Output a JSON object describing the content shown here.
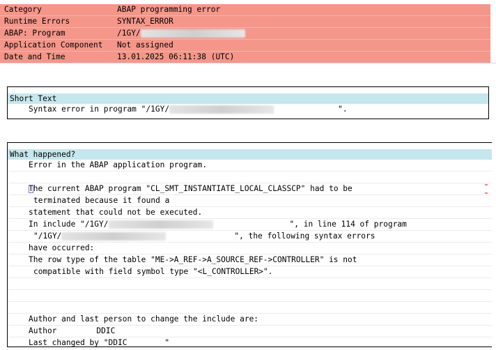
{
  "header": {
    "rows": [
      {
        "key": "Category",
        "value": "ABAP programming error"
      },
      {
        "key": "Runtime Errors",
        "value": "SYNTAX_ERROR"
      },
      {
        "key": "ABAP: Program",
        "value": "/1GY/"
      },
      {
        "key": "Application Component",
        "value": "Not assigned"
      },
      {
        "key": "Date and Time",
        "value": "13.01.2025 06:11:38 (UTC)"
      }
    ]
  },
  "short_text": {
    "title": "Short Text",
    "line_prefix": "Syntax error in program \"/1GY/",
    "line_suffix": "\"."
  },
  "what_happened": {
    "title": "What happened?",
    "intro": "Error in the ABAP application program.",
    "l1": "he current ABAP program \"CL_SMT_INSTANTIATE_LOCAL_CLASSCP\" had to be",
    "l1_first": "T",
    "l2": "terminated because it found a",
    "l3": "statement that could not be executed.",
    "l4_prefix": "In include \"/1GY/",
    "l4_suffix": "\", in line 114 of program",
    "l5_prefix": "\"/1GY/",
    "l5_suffix": "\", the following syntax errors",
    "l6": "have occurred:",
    "l7": "The row type of the table \"ME->A_REF->A_SOURCE_REF->CONTROLLER\" is not",
    "l8": "compatible with field symbol type \"<L_CONTROLLER>\".",
    "l9": "Author and last person to change the include are:",
    "l10_label": "Author",
    "l10_value": "DDIC",
    "l11": "Last changed by \"DDIC        \""
  }
}
